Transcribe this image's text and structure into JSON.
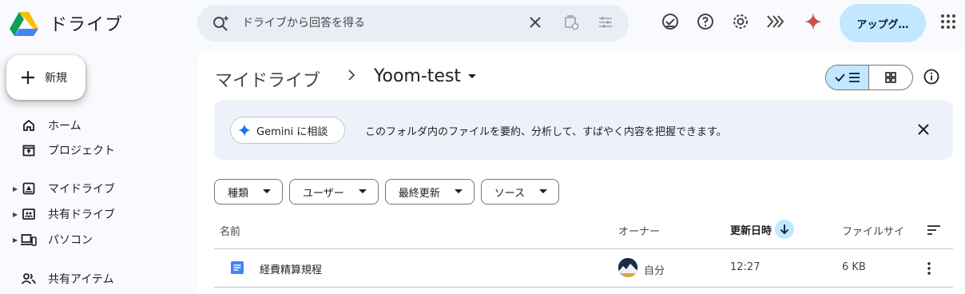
{
  "app": {
    "title": "ドライブ",
    "logo_icon": "google-drive-logo"
  },
  "search": {
    "placeholder": "ドライブから回答を得る"
  },
  "header": {
    "upgrade_label": "アップグ…"
  },
  "sidebar": {
    "new_label": "新規",
    "items": [
      {
        "label": "ホーム",
        "icon": "home-icon"
      },
      {
        "label": "プロジェクト",
        "icon": "project-icon"
      },
      {
        "label": "マイドライブ",
        "icon": "my-drive-icon"
      },
      {
        "label": "共有ドライブ",
        "icon": "shared-drive-icon"
      },
      {
        "label": "パソコン",
        "icon": "computer-icon"
      },
      {
        "label": "共有アイテム",
        "icon": "shared-icon"
      }
    ]
  },
  "breadcrumb": {
    "root": "マイドライブ",
    "current": "Yoom-test"
  },
  "gemini": {
    "chip_label": "Gemini に相談",
    "message": "このフォルダ内のファイルを要約、分析して、すばやく内容を把握できます。"
  },
  "filters": [
    "種類",
    "ユーザー",
    "最終更新",
    "ソース"
  ],
  "table": {
    "columns": [
      "名前",
      "オーナー",
      "更新日時",
      "ファイルサイ"
    ],
    "sorted_column": "更新日時",
    "rows": [
      {
        "name": "経費精算規程",
        "owner": "自分",
        "modified": "12:27",
        "size": "6 KB",
        "type_icon": "docs-icon"
      }
    ]
  },
  "colors": {
    "accent": "#c2e7ff",
    "docs": "#4285f4",
    "panel_bg": "#f8fafd"
  }
}
